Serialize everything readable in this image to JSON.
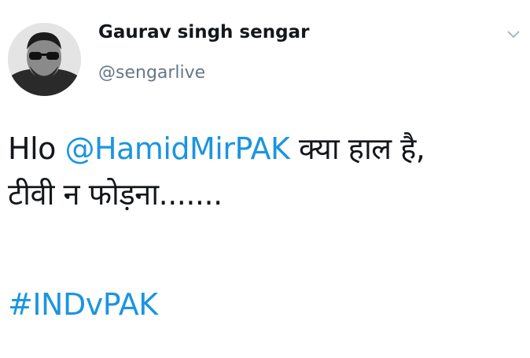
{
  "author": {
    "display_name": "Gaurav singh sengar",
    "handle": "@sengarlive"
  },
  "menu": {
    "icon": "chevron-down-icon"
  },
  "tweet": {
    "line1": {
      "prefix": "Hlo ",
      "mention": "@HamidMirPAK",
      "suffix": " क्या हाल है,"
    },
    "line2": "टीवी न फोड़ना.......",
    "hashtag": "#INDvPAK"
  },
  "colors": {
    "link": "#1b95e0",
    "handle": "#657786",
    "text": "#14171a"
  }
}
